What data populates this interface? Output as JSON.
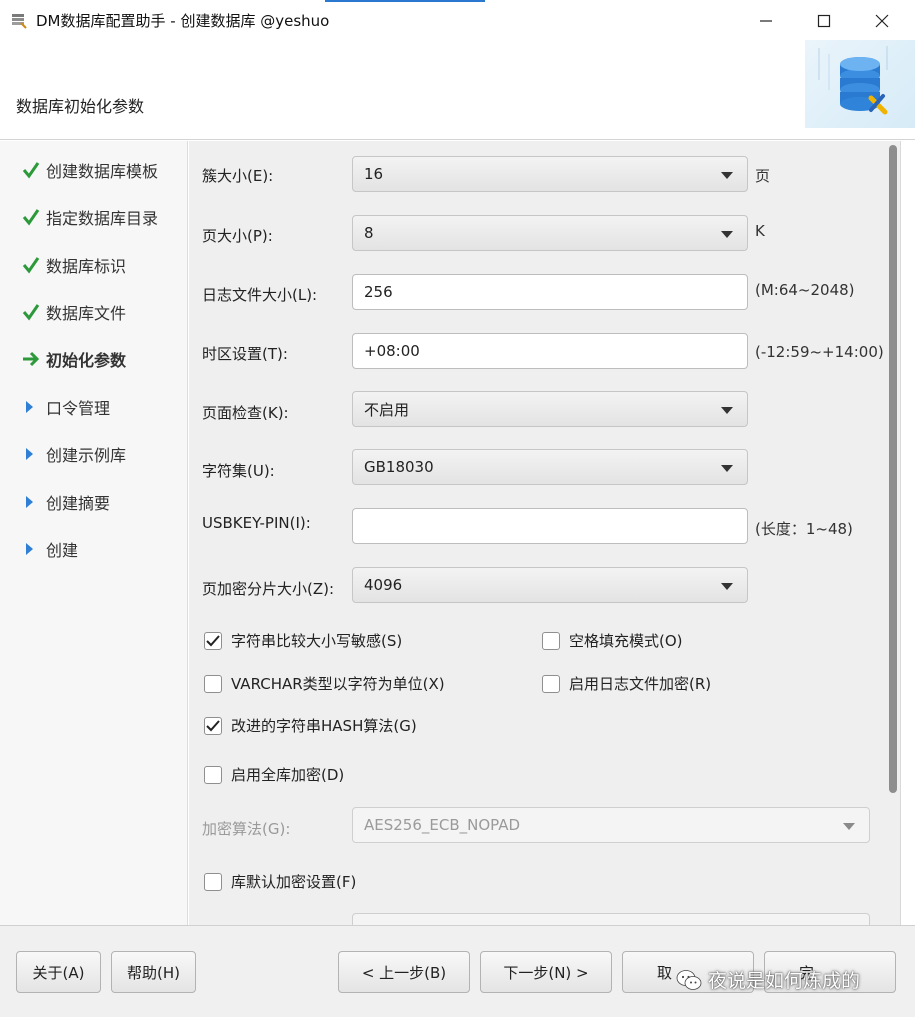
{
  "window": {
    "title": "DM数据库配置助手 - 创建数据库 @yeshuo",
    "page_title": "数据库初始化参数"
  },
  "steps": [
    {
      "label": "创建数据库模板",
      "state": "done"
    },
    {
      "label": "指定数据库目录",
      "state": "done"
    },
    {
      "label": "数据库标识",
      "state": "done"
    },
    {
      "label": "数据库文件",
      "state": "done"
    },
    {
      "label": "初始化参数",
      "state": "current"
    },
    {
      "label": "口令管理",
      "state": "pending"
    },
    {
      "label": "创建示例库",
      "state": "pending"
    },
    {
      "label": "创建摘要",
      "state": "pending"
    },
    {
      "label": "创建",
      "state": "pending"
    }
  ],
  "form": {
    "extent_size": {
      "label": "簇大小(E):",
      "value": "16",
      "unit": "页"
    },
    "page_size": {
      "label": "页大小(P):",
      "value": "8",
      "unit": "K"
    },
    "log_size": {
      "label": "日志文件大小(L):",
      "value": "256",
      "hint": "(M:64~2048)"
    },
    "time_zone": {
      "label": "时区设置(T):",
      "value": "+08:00",
      "hint": "(-12:59~+14:00)"
    },
    "page_check": {
      "label": "页面检查(K):",
      "value": "不启用"
    },
    "charset": {
      "label": "字符集(U):",
      "value": "GB18030"
    },
    "usbkey_pin": {
      "label": "USBKEY-PIN(I):",
      "value": "",
      "hint": "(长度：1~48)"
    },
    "blank_pad_size": {
      "label": "页加密分片大小(Z):",
      "value": "4096"
    },
    "checkboxes": {
      "case_sensitive": {
        "label": "字符串比较大小写敏感(S)",
        "checked": true
      },
      "blank_pad_mode": {
        "label": "空格填充模式(O)",
        "checked": false
      },
      "length_in_char": {
        "label": "VARCHAR类型以字符为单位(X)",
        "checked": false
      },
      "log_encrypt": {
        "label": "启用日志文件加密(R)",
        "checked": false
      },
      "hash_algorithm": {
        "label": "改进的字符串HASH算法(G)",
        "checked": true
      },
      "full_encrypt": {
        "label": "启用全库加密(D)",
        "checked": false
      },
      "default_encrypt": {
        "label": "库默认加密设置(F)",
        "checked": false
      }
    },
    "encrypt_algorithm": {
      "label": "加密算法(G):",
      "value": "AES256_ECB_NOPAD",
      "disabled": true
    }
  },
  "buttons": {
    "about": "关于(A)",
    "help": "帮助(H)",
    "prev": "< 上一步(B)",
    "next": "下一步(N) >",
    "cancel": "取",
    "finish": "完"
  },
  "watermark": "夜说是如何炼成的",
  "colors": {
    "check_green": "#2c9a3a",
    "arrow_green": "#2c9a3a",
    "pending_blue": "#2f7fd6",
    "accent_blue": "#2b78d0"
  },
  "icons": {
    "app": "database-wrench-icon",
    "banner": "database-stack-icon"
  }
}
